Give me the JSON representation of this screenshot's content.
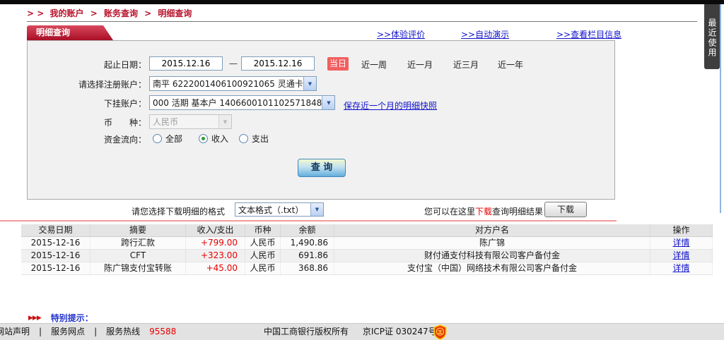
{
  "colors": {
    "accent-red": "#b8112a",
    "link-blue": "#1111cc",
    "amount-red": "#e60000",
    "notice-blue": "#2233cc"
  },
  "breadcrumb": {
    "prefix": "> >",
    "separator": ">",
    "items": [
      "我的账户",
      "账务查询",
      "明细查询"
    ]
  },
  "tab_title": "明细查询",
  "header_links": [
    ">>体验评价",
    ">>自动演示",
    ">>查看栏目信息"
  ],
  "recent_tab": "最近使用",
  "form": {
    "date_label": "起止日期：",
    "date_from": "2015.12.16",
    "date_dash": "—",
    "date_to": "2015.12.16",
    "range_active": "当日",
    "range_options": [
      "近一周",
      "近一月",
      "近三月",
      "近一年"
    ],
    "account_label": "请选择注册账户：",
    "account_value": "南平  6222001406100921065 灵通卡",
    "sub_account_label": "下挂账户：",
    "sub_account_value": "000 活期 基本户 1406600101102571848",
    "snapshot_link": "保存近一个月的明细快照",
    "currency_label": "币　　种：",
    "currency_value": "人民币",
    "flow_label": "资金流向：",
    "flow_options": [
      {
        "label": "全部",
        "checked": false
      },
      {
        "label": "收入",
        "checked": true
      },
      {
        "label": "支出",
        "checked": false
      }
    ],
    "query_button": "查 询"
  },
  "download": {
    "format_label": "请您选择下载明细的格式",
    "format_value": "文本格式（.txt）",
    "hint_pre": "您可以在这里",
    "hint_highlight": "下载",
    "hint_post": "查询明细结果",
    "button": "下载"
  },
  "table": {
    "headers": [
      "交易日期",
      "摘要",
      "收入/支出",
      "币种",
      "余额",
      "对方户名",
      "操作"
    ],
    "rows": [
      {
        "date": "2015-12-16",
        "summary": "跨行汇款",
        "amount": "+799.00",
        "currency": "人民币",
        "balance": "1,490.86",
        "counterparty": "陈广锦",
        "action": "详情"
      },
      {
        "date": "2015-12-16",
        "summary": "CFT",
        "amount": "+323.00",
        "currency": "人民币",
        "balance": "691.86",
        "counterparty": "财付通支付科技有限公司客户备付金",
        "action": "详情"
      },
      {
        "date": "2015-12-16",
        "summary": "陈广锦支付宝转账",
        "amount": "+45.00",
        "currency": "人民币",
        "balance": "368.86",
        "counterparty": "支付宝（中国）网络技术有限公司客户备付金",
        "action": "详情"
      }
    ]
  },
  "notice": {
    "arrows": "▶▶▶",
    "label": "特别提示："
  },
  "footer": {
    "site_statement": "网站声明",
    "separator": "|",
    "service_outlets": "服务网点",
    "hotline_label": "服务热线",
    "hotline_number": "95588",
    "copyright": "中国工商银行版权所有",
    "icp": "京ICP证 030247号"
  }
}
